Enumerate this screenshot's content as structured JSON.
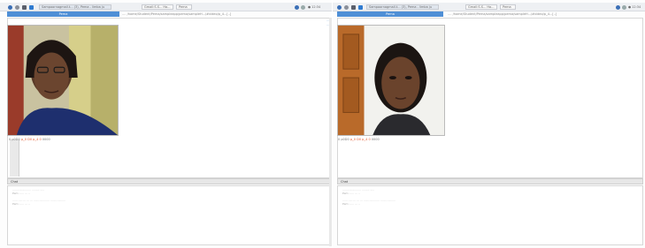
{
  "left": {
    "taskbar": {
      "items": [
        "",
        "",
        "",
        "",
        "Sampoornagmail.t... (3), Pema - limba ju",
        "",
        "",
        "",
        ""
      ],
      "window_a": "Gmail:S.S... Ha...",
      "window_b": "Pema",
      "right": "● 12:34"
    },
    "header": {
      "label": "Pema"
    },
    "url": "....  /home/Student/Pema/sampleapp/pema/sampleH.../#video/p_4...[..]",
    "caption": {
      "prefix": "0 p0D0 ",
      "highlight": "p_0 D0 p_4 0",
      "suffix": " 0000"
    },
    "section": "Chat",
    "log": [
      "...................... ......... .....",
      "Pem: ..... ... ..",
      "...... ..... ... ... ... ...... ............ ....... ..........",
      "Pem: ..... ... .."
    ],
    "side_mini": [
      "......",
      "......"
    ]
  },
  "right": {
    "taskbar": {
      "items": [
        "",
        "",
        "",
        "",
        "Sampoornagmail.t... (3), Pema - limba ju",
        "",
        "",
        "",
        ""
      ],
      "window_a": "Gmail:S.S... Ha...",
      "window_b": "Pema",
      "right": "● 12:34"
    },
    "header": {
      "label": "Pema"
    },
    "url": "....  /home/Student/Pema/sampleapp/pema/sampleH.../#video/p_4...[..]",
    "caption": {
      "prefix": "0 p0D0 ",
      "highlight": "p_0 D0 p_4 0",
      "suffix": " 0000"
    },
    "section": "Chat",
    "log": [
      "...................... ......... .....",
      "Pem: ..... ... ..",
      "...... ..... ... ... ... ...... ............ ....... ..........",
      "Pem: ..... ... .."
    ]
  },
  "colors": {
    "accent": "#4f8fd6",
    "highlight": "#e0542a"
  },
  "icons": [
    "globe-icon",
    "network-icon",
    "sound-icon",
    "app-icon"
  ]
}
